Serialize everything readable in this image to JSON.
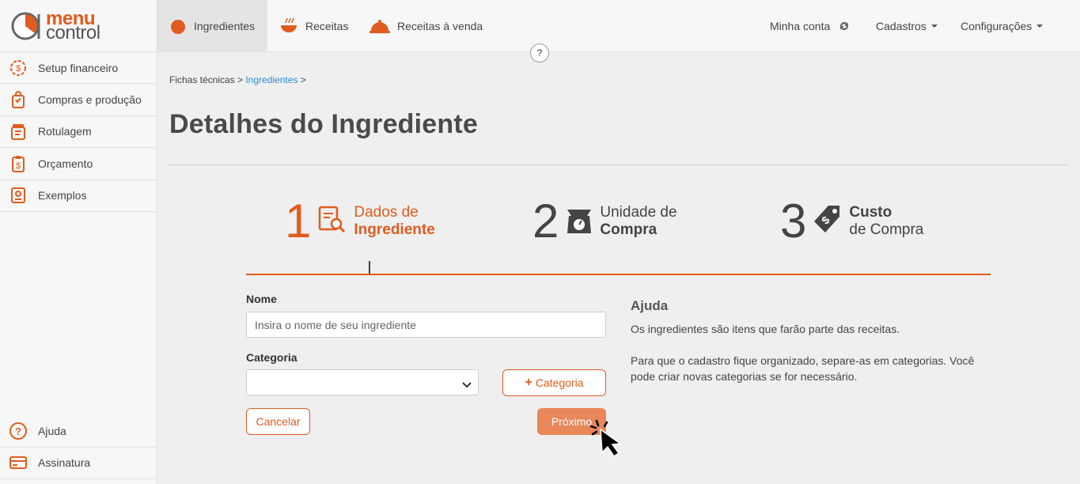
{
  "brand": {
    "line1": "menu",
    "line2": "control",
    "accent": "#e05c1e"
  },
  "sidebar": {
    "items": [
      {
        "label": "Setup financeiro",
        "icon": "gear-dollar-icon"
      },
      {
        "label": "Compras e produção",
        "icon": "shopping-bag-icon"
      },
      {
        "label": "Rotulagem",
        "icon": "jar-label-icon"
      },
      {
        "label": "Orçamento",
        "icon": "clipboard-dollar-icon"
      },
      {
        "label": "Exemplos",
        "icon": "book-icon"
      }
    ],
    "bottom": [
      {
        "label": "Ajuda",
        "icon": "help-icon"
      },
      {
        "label": "Assinatura",
        "icon": "card-icon"
      }
    ]
  },
  "topnav": {
    "tabs": [
      {
        "label": "Ingredientes",
        "icon": "tomato-icon",
        "active": true
      },
      {
        "label": "Receitas",
        "icon": "pot-icon"
      },
      {
        "label": "Receitas à venda",
        "icon": "cloche-icon"
      }
    ],
    "account": "Minha conta",
    "cadastros": "Cadastros",
    "configuracoes": "Configurações",
    "help_bubble": "?"
  },
  "breadcrumb": {
    "part1": "Fichas técnicas >",
    "link": "Ingredientes",
    "part2": ">"
  },
  "page_title": "Detalhes do Ingrediente",
  "steps": [
    {
      "num": "1",
      "line1": "Dados de",
      "line2": "Ingrediente"
    },
    {
      "num": "2",
      "line1": "Unidade de",
      "line2": "Compra"
    },
    {
      "num": "3",
      "line1": "Custo",
      "line2": "de Compra"
    }
  ],
  "form": {
    "name_label": "Nome",
    "name_placeholder": "Insira o nome de seu ingrediente",
    "category_label": "Categoria",
    "add_category": "Categoria",
    "cancel": "Cancelar",
    "next": "Próximo"
  },
  "help": {
    "title": "Ajuda",
    "p1": "Os ingredientes são itens que farão parte das receitas.",
    "p2": "Para que o cadastro fique organizado, separe-as em categorias. Você pode criar novas categorias se for necessário."
  }
}
